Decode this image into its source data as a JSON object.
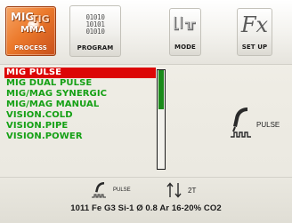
{
  "tabs": {
    "process": {
      "label": "PROCESS",
      "logo_text": {
        "mig": "MIG",
        "tig": "TIG",
        "mma": "MMA"
      }
    },
    "program": {
      "label": "PROGRAM",
      "bits": "01010\n10101\n01010"
    },
    "mode": {
      "label": "MODE"
    },
    "setup": {
      "label": "SET UP",
      "glyph": "Fx"
    }
  },
  "process_list": {
    "items": [
      {
        "label": "MIG PULSE",
        "selected": true
      },
      {
        "label": "MIG DUAL PULSE",
        "selected": false
      },
      {
        "label": "MIG/MAG SYNERGIC",
        "selected": false
      },
      {
        "label": "MIG/MAG MANUAL",
        "selected": false
      },
      {
        "label": "VISION.COLD",
        "selected": false
      },
      {
        "label": "VISION.PIPE",
        "selected": false
      },
      {
        "label": "VISION.POWER",
        "selected": false
      }
    ],
    "selected_color": "#dc0606",
    "item_color": "#14a014",
    "scroll_position": 0.0,
    "scroll_visible_fraction": 0.4
  },
  "current_mode": {
    "label": "PULSE",
    "icon": "torch-pulse-icon"
  },
  "status_bar": {
    "pulse": {
      "label": "PULSE",
      "icon": "torch-pulse-icon"
    },
    "trigger": {
      "label": "2T",
      "icon": "up-down-arrows-icon"
    },
    "parameters": "1011 Fe G3 Si-1 Ø 0.8 Ar 16-20% CO2"
  }
}
